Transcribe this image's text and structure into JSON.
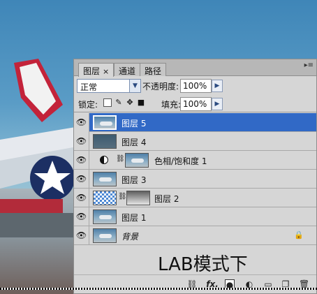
{
  "panel": {
    "tabs": [
      {
        "label": "图层",
        "close": "×"
      },
      {
        "label": "通道"
      },
      {
        "label": "路径"
      }
    ],
    "menu_icon": "panel-menu-icon",
    "blend_mode": "正常",
    "opacity_label": "不透明度:",
    "opacity_value": "100%",
    "lock_label": "锁定:",
    "fill_label": "填充:",
    "fill_value": "100%",
    "layers": [
      {
        "name": "图层 5",
        "selected": true
      },
      {
        "name": "图层 4"
      },
      {
        "name": "色相/饱和度 1"
      },
      {
        "name": "图层 3"
      },
      {
        "name": "图层 2"
      },
      {
        "name": "图层 1"
      },
      {
        "name": "背景"
      }
    ],
    "caption": "LAB模式下",
    "footer_icons": [
      "link-icon",
      "fx-icon",
      "mask-icon",
      "adjustment-icon",
      "group-folder-icon",
      "new-layer-icon",
      "trash-icon"
    ],
    "fx_label": "fx."
  }
}
